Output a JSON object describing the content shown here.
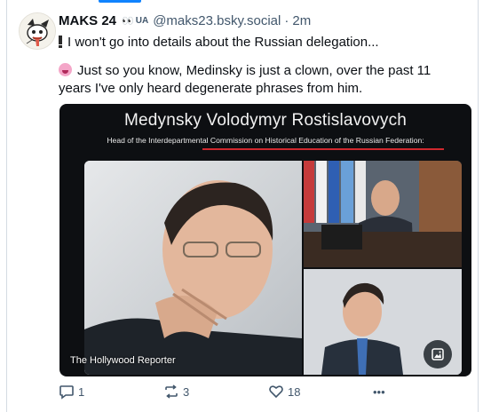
{
  "post": {
    "author": {
      "display_name": "MAKS 24",
      "badge_emoji": "👀",
      "country_tag": "UA",
      "handle": "@maks23.bsky.social",
      "separator": "·",
      "timestamp": "2m"
    },
    "text": {
      "line1": "I won't go into details about the Russian delegation...",
      "line2": "Just so you know, Medinsky is just a clown, over the past 11 years I've only heard degenerate phrases from him."
    },
    "media": {
      "title": "Medynsky Volodymyr Rostislavovych",
      "subtitle": "Head of the Interdepartmental Commission on Historical Education of the Russian Federation:",
      "caption": "The Hollywood Reporter",
      "alt_icon": "image-alt-icon"
    },
    "actions": {
      "reply_count": "1",
      "repost_count": "3",
      "like_count": "18",
      "more_label": "•••"
    }
  },
  "colors": {
    "accent": "#1083fe",
    "muted": "#42576c",
    "underline": "#d0282e"
  }
}
